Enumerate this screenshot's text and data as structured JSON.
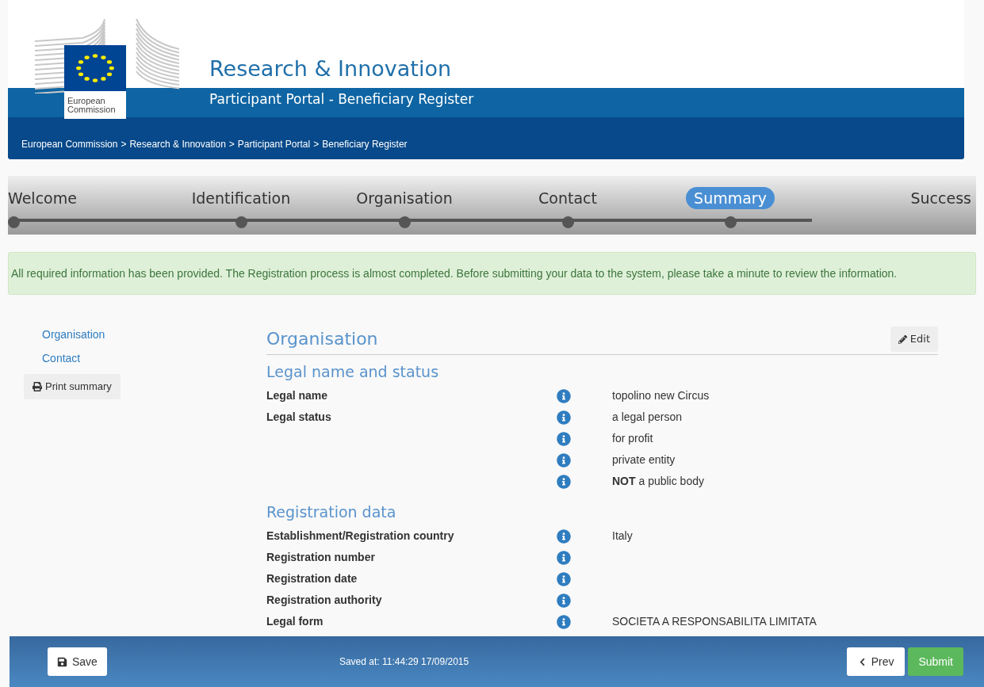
{
  "header": {
    "logo_text": [
      "European",
      "Commission"
    ],
    "title": "Research & Innovation",
    "subtitle": "Participant Portal - Beneficiary Register"
  },
  "breadcrumb": [
    {
      "label": "European Commission",
      "separator": ">"
    },
    {
      "label": "Research & Innovation",
      "separator": ">"
    },
    {
      "label": "Participant Portal",
      "separator": ">"
    },
    {
      "label": "Beneficiary Register"
    }
  ],
  "steps": [
    {
      "label": "Welcome",
      "selected": false,
      "dot": true
    },
    {
      "label": "Identification",
      "selected": false,
      "dot": true
    },
    {
      "label": "Organisation",
      "selected": false,
      "dot": true
    },
    {
      "label": "Contact",
      "selected": false,
      "dot": true
    },
    {
      "label": "Summary",
      "selected": true,
      "dot": true
    },
    {
      "label": "Success",
      "selected": false,
      "dot": false
    }
  ],
  "alert": "All required information has been provided. The Registration process is almost completed. Before submitting your data to the system, please take a minute to review the information.",
  "side_nav": {
    "links": [
      "Organisation",
      "Contact"
    ],
    "print_button": "Print summary"
  },
  "panel": {
    "title": "Organisation",
    "edit_button": "Edit",
    "sections": [
      {
        "title": "Legal name and status",
        "rows": [
          {
            "label": "Legal name",
            "value": "topolino new Circus"
          },
          {
            "label": "Legal status",
            "value": "a legal person"
          },
          {
            "value": "for profit"
          },
          {
            "value": "private entity"
          },
          {
            "value": "**NOT** a public body"
          }
        ]
      },
      {
        "title": "Registration data",
        "rows": [
          {
            "label": "Establishment/Registration country",
            "value": "Italy"
          },
          {
            "label": "Registration number"
          },
          {
            "label": "Registration date"
          },
          {
            "label": "Registration authority"
          },
          {
            "label": "Legal form",
            "value": "SOCIETA A RESPONSABILITA LIMITATA"
          }
        ]
      }
    ]
  },
  "footer": {
    "save_button": "Save",
    "saved_at": "Saved at: 11:44:29 17/09/2015",
    "prev_button": "Prev",
    "submit_button": "Submit"
  }
}
